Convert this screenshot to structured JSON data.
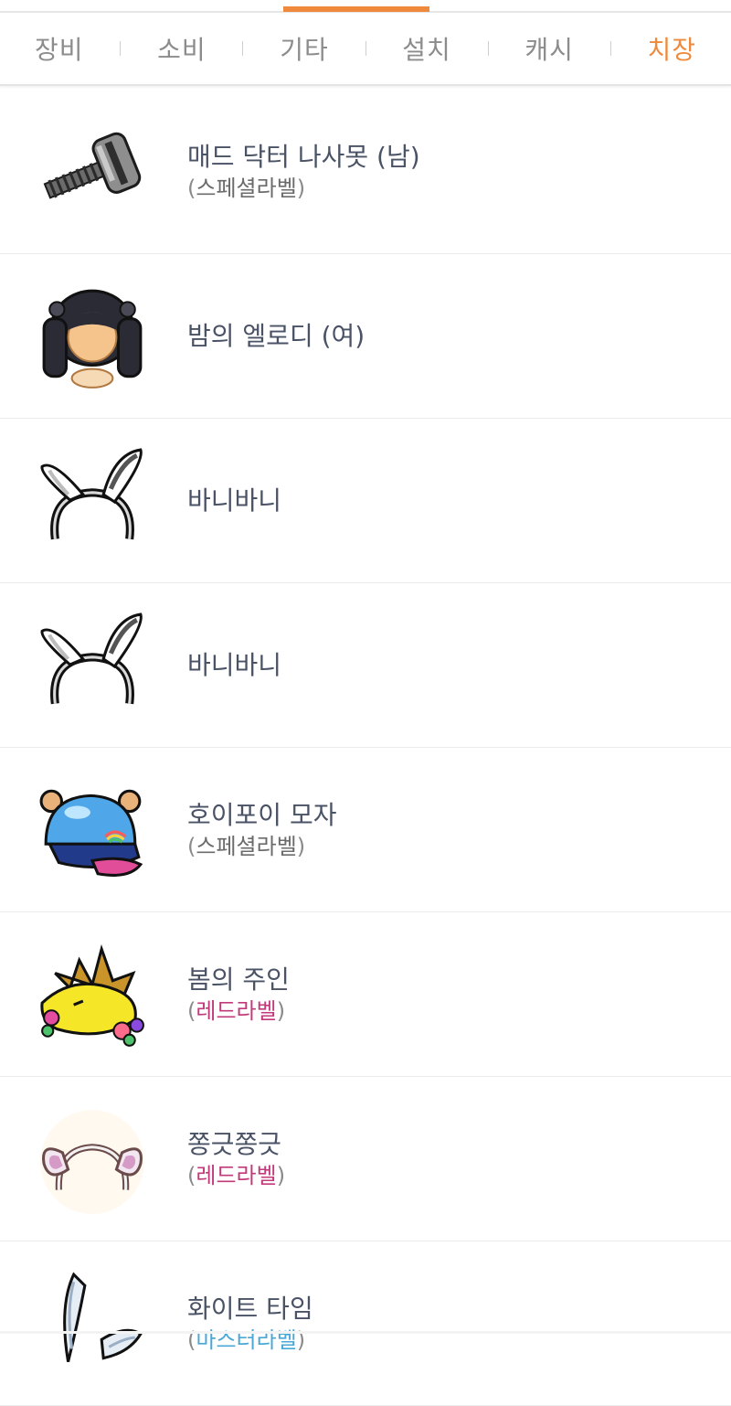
{
  "tabs": [
    {
      "label": "장비",
      "active": false
    },
    {
      "label": "소비",
      "active": false
    },
    {
      "label": "기타",
      "active": false
    },
    {
      "label": "설치",
      "active": false
    },
    {
      "label": "캐시",
      "active": false
    },
    {
      "label": "치장",
      "active": true
    }
  ],
  "items": [
    {
      "name": "매드 닥터 나사못 (남)",
      "label_open": "(",
      "label": "스페셜라벨",
      "label_close": ")",
      "icon": "screw-icon"
    },
    {
      "name": "밤의 엘로디 (여)",
      "label_open": "",
      "label": "",
      "label_close": "",
      "icon": "black-hair-icon"
    },
    {
      "name": "바니바니",
      "label_open": "",
      "label": "",
      "label_close": "",
      "icon": "bunny-ears-headband-icon"
    },
    {
      "name": "바니바니",
      "label_open": "",
      "label": "",
      "label_close": "",
      "icon": "bunny-ears-headband-icon"
    },
    {
      "name": "호이포이 모자",
      "label_open": "(",
      "label": "스페셜라벨",
      "label_close": ")",
      "icon": "blue-cap-icon"
    },
    {
      "name": "봄의 주인",
      "label_open": "(",
      "label": "레드라벨",
      "label_close": ")",
      "icon": "flower-crown-icon"
    },
    {
      "name": "쫑긋쫑긋",
      "label_open": "(",
      "label": "레드라벨",
      "label_close": ")",
      "icon": "pink-ears-headband-icon"
    },
    {
      "name": "화이트 타임",
      "label_open": "(",
      "label": "마스터라벨",
      "label_close": ")",
      "icon": "white-wing-icon"
    }
  ],
  "colors": {
    "accent": "#ef8a3c",
    "red_label": "#c23a7a",
    "master_label": "#4aa8d6",
    "text": "#4a5266"
  }
}
